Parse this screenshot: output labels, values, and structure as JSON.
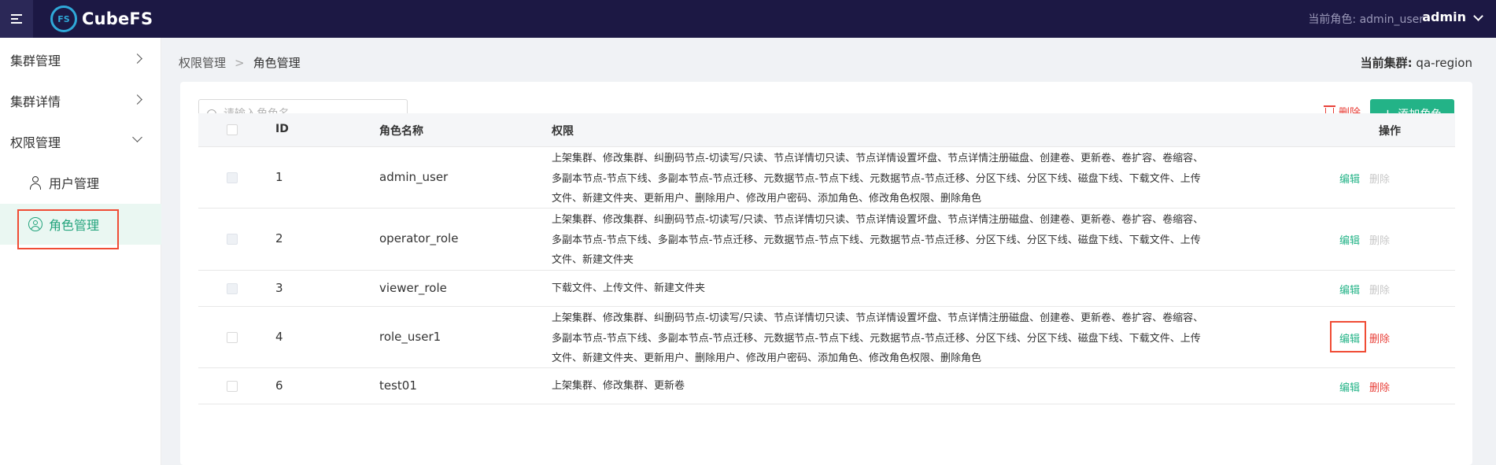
{
  "topbar": {
    "logo_mark": "FS",
    "logo_text": "CubeFS",
    "current_role_label": "当前角色: admin_user",
    "user_name": "admin"
  },
  "sidebar": {
    "items": [
      {
        "label": "集群管理"
      },
      {
        "label": "集群详情"
      },
      {
        "label": "权限管理"
      }
    ],
    "subitems": [
      {
        "label": "用户管理"
      },
      {
        "label": "角色管理"
      }
    ]
  },
  "breadcrumb": {
    "parent": "权限管理",
    "separator": ">",
    "current": "角色管理"
  },
  "cluster": {
    "label": "当前集群:",
    "value": "qa-region"
  },
  "toolbar": {
    "search_placeholder": "请输入角色名",
    "delete_label": "删除",
    "add_label": "添加角色",
    "add_plus": "+"
  },
  "table": {
    "headers": {
      "id": "ID",
      "name": "角色名称",
      "perm": "权限",
      "op": "操作"
    },
    "edit_label": "编辑",
    "delete_label": "删除",
    "rows": [
      {
        "id": "1",
        "name": "admin_user",
        "perm_lines": [
          "上架集群、修改集群、纠删码节点-切读写/只读、节点详情切只读、节点详情设置坏盘、节点详情注册磁盘、创建卷、更新卷、卷扩容、卷缩容、",
          "多副本节点-节点下线、多副本节点-节点迁移、元数据节点-节点下线、元数据节点-节点迁移、分区下线、分区下线、磁盘下线、下载文件、上传",
          "文件、新建文件夹、更新用户、删除用户、修改用户密码、添加角色、修改角色权限、删除角色"
        ]
      },
      {
        "id": "2",
        "name": "operator_role",
        "perm_lines": [
          "上架集群、修改集群、纠删码节点-切读写/只读、节点详情切只读、节点详情设置坏盘、节点详情注册磁盘、创建卷、更新卷、卷扩容、卷缩容、",
          "多副本节点-节点下线、多副本节点-节点迁移、元数据节点-节点下线、元数据节点-节点迁移、分区下线、分区下线、磁盘下线、下载文件、上传",
          "文件、新建文件夹"
        ]
      },
      {
        "id": "3",
        "name": "viewer_role",
        "perm_lines": [
          "下载文件、上传文件、新建文件夹"
        ]
      },
      {
        "id": "4",
        "name": "role_user1",
        "perm_lines": [
          "上架集群、修改集群、纠删码节点-切读写/只读、节点详情切只读、节点详情设置坏盘、节点详情注册磁盘、创建卷、更新卷、卷扩容、卷缩容、",
          "多副本节点-节点下线、多副本节点-节点迁移、元数据节点-节点下线、元数据节点-节点迁移、分区下线、分区下线、磁盘下线、下载文件、上传",
          "文件、新建文件夹、更新用户、删除用户、修改用户密码、添加角色、修改角色权限、删除角色"
        ]
      },
      {
        "id": "6",
        "name": "test01",
        "perm_lines": [
          "上架集群、修改集群、更新卷"
        ]
      }
    ]
  }
}
